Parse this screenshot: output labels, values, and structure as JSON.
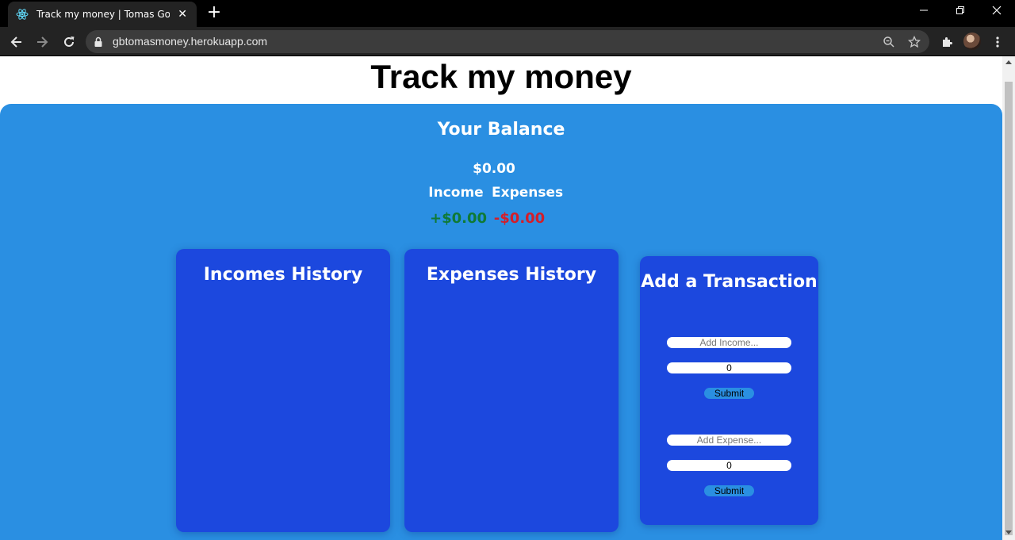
{
  "browser": {
    "tab_title": "Track my money | Tomas Gomez",
    "new_tab_label": "+",
    "url": "gbtomasmoney.herokuapp.com"
  },
  "page": {
    "title": "Track my money"
  },
  "balance": {
    "heading": "Your Balance",
    "amount": "$0.00",
    "income_label": "Income",
    "expenses_label": "Expenses",
    "income_value": "+$0.00",
    "expenses_value": "-$0.00"
  },
  "incomes_history": {
    "heading": "Incomes History"
  },
  "expenses_history": {
    "heading": "Expenses History"
  },
  "transaction_form": {
    "heading": "Add a Transaction",
    "income_placeholder": "Add Income...",
    "income_amount": "0",
    "income_submit": "Submit",
    "expense_placeholder": "Add Expense...",
    "expense_amount": "0",
    "expense_submit": "Submit"
  },
  "colors": {
    "panel_bg": "#2a8fe2",
    "card_bg": "#1c48de",
    "income_green": "#0f7a36",
    "expense_red": "#d21e2a"
  }
}
